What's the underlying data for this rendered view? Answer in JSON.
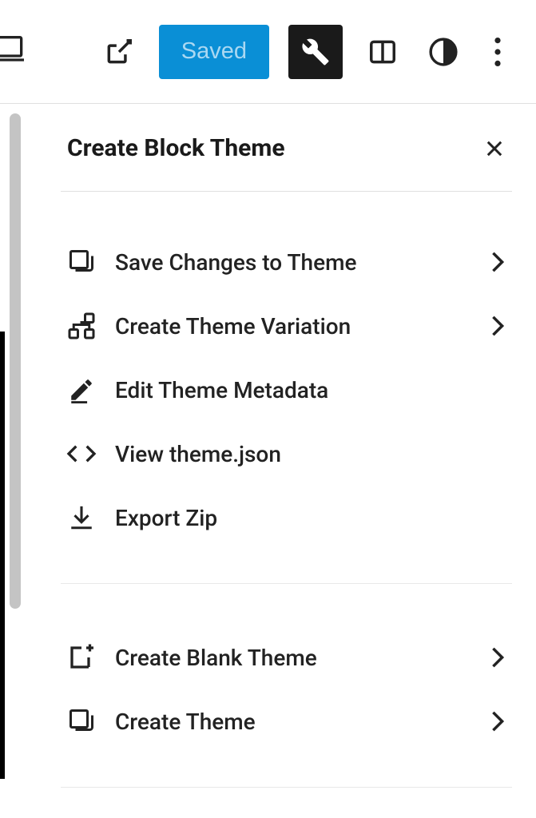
{
  "toolbar": {
    "saved_label": "Saved"
  },
  "panel": {
    "title": "Create Block Theme"
  },
  "menu": {
    "section1": [
      {
        "label": "Save Changes to Theme",
        "icon": "copy-icon",
        "chevron": true
      },
      {
        "label": "Create Theme Variation",
        "icon": "branch-icon",
        "chevron": true
      },
      {
        "label": "Edit Theme Metadata",
        "icon": "pencil-icon",
        "chevron": false
      },
      {
        "label": "View theme.json",
        "icon": "code-icon",
        "chevron": false
      },
      {
        "label": "Export Zip",
        "icon": "download-icon",
        "chevron": false
      }
    ],
    "section2": [
      {
        "label": "Create Blank Theme",
        "icon": "create-new-icon",
        "chevron": true
      },
      {
        "label": "Create Theme",
        "icon": "copy-icon",
        "chevron": true
      }
    ]
  }
}
